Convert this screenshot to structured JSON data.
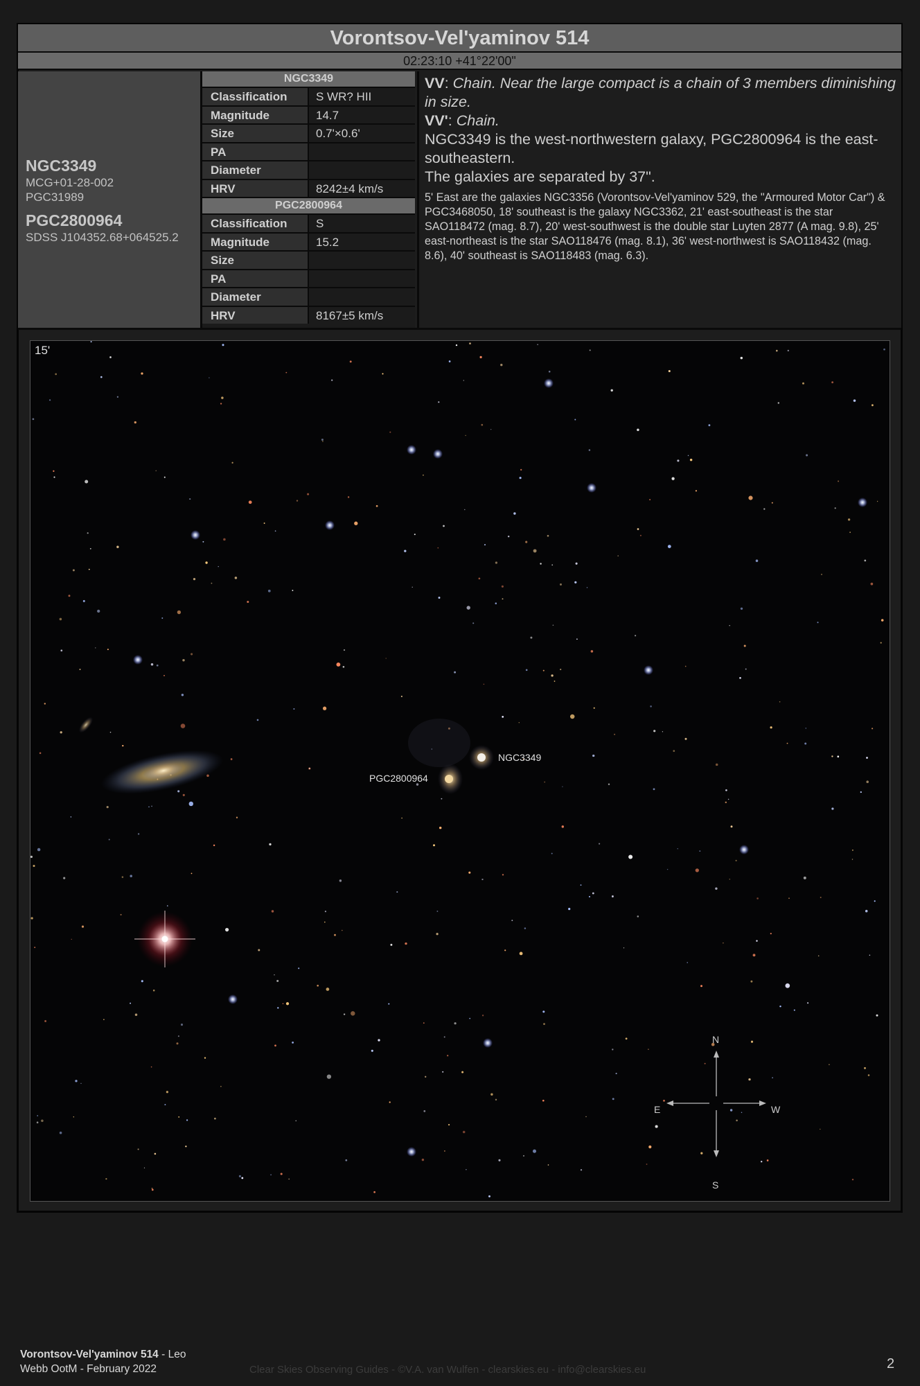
{
  "title": "Vorontsov-Vel'yaminov 514",
  "coords": "02:23:10 +41°22'00\"",
  "objects": {
    "primary_name": "NGC3349",
    "primary_aliases": [
      "MCG+01-28-002",
      "PGC31989"
    ],
    "secondary_name": "PGC2800964",
    "secondary_aliases": [
      "SDSS J104352.68+064525.2"
    ]
  },
  "table1": {
    "header": "NGC3349",
    "rows": [
      {
        "key": "Classification",
        "value": "S WR? HII"
      },
      {
        "key": "Magnitude",
        "value": "14.7"
      },
      {
        "key": "Size",
        "value": "0.7'×0.6'"
      },
      {
        "key": "PA",
        "value": ""
      },
      {
        "key": "Diameter",
        "value": ""
      },
      {
        "key": "HRV",
        "value": "8242±4 km/s"
      }
    ]
  },
  "table2": {
    "header": "PGC2800964",
    "rows": [
      {
        "key": "Classification",
        "value": "S"
      },
      {
        "key": "Magnitude",
        "value": "15.2"
      },
      {
        "key": "Size",
        "value": ""
      },
      {
        "key": "PA",
        "value": ""
      },
      {
        "key": "Diameter",
        "value": ""
      },
      {
        "key": "HRV",
        "value": "8167±5 km/s"
      }
    ]
  },
  "description": {
    "vv_label": "VV",
    "vv_text": "Chain. Near the large compact is a chain of 3 members diminishing in size.",
    "vvp_label": "VV'",
    "vvp_text": "Chain.",
    "obs1": "NGC3349 is the west-northwestern galaxy, PGC2800964 is the east-southeastern.",
    "obs2": "The galaxies are separated by 37\".",
    "surroundings": "5' East are the galaxies NGC3356 (Vorontsov-Vel'yaminov 529, the \"Armoured Motor Car\") & PGC3468050, 18' southeast is the galaxy NGC3362, 21' east-southeast is the star SAO118472 (mag. 8.7), 20' west-southwest is the double star Luyten 2877 (A mag. 9.8), 25' east-northeast is the star SAO118476 (mag. 8.1), 36' west-northwest is SAO118432 (mag. 8.6), 40' southeast is SAO118483 (mag. 6.3)."
  },
  "image": {
    "scale_label": "15'",
    "label_ngc": "NGC3349",
    "label_pgc": "PGC2800964",
    "compass": {
      "n": "N",
      "s": "S",
      "e": "E",
      "w": "W"
    }
  },
  "footer": {
    "object": "Vorontsov-Vel'yaminov 514",
    "constellation_sep": " - Leo",
    "line2": "Webb OotM - February 2022",
    "credit": "Clear Skies Observing Guides - ©V.A. van Wulfen - clearskies.eu - info@clearskies.eu",
    "page": "2"
  }
}
